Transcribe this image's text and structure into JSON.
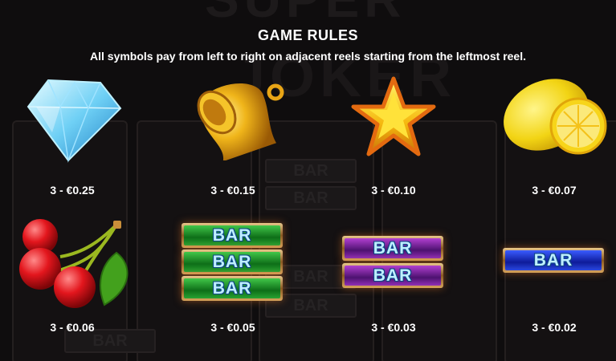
{
  "header": {
    "title": "GAME RULES",
    "subtitle": "All symbols pay from left to right on adjacent reels starting from the leftmost reel."
  },
  "background": {
    "logo_text_top": "SUPER",
    "logo_text_mid": "JOKER",
    "reel_bar_label": "BAR"
  },
  "symbols": [
    {
      "name": "diamond",
      "icon": "diamond-icon",
      "payout": "3 - €0.25"
    },
    {
      "name": "bell",
      "icon": "bell-icon",
      "payout": "3 - €0.15"
    },
    {
      "name": "star",
      "icon": "star-icon",
      "payout": "3 - €0.10"
    },
    {
      "name": "lemon",
      "icon": "lemon-icon",
      "payout": "3 - €0.07"
    },
    {
      "name": "cherry",
      "icon": "cherry-icon",
      "payout": "3 - €0.06"
    },
    {
      "name": "triple-bar",
      "bar_labels": [
        "BAR",
        "BAR",
        "BAR"
      ],
      "color": "#1f9a2a",
      "payout": "3 - €0.05"
    },
    {
      "name": "double-bar",
      "bar_labels": [
        "BAR",
        "BAR"
      ],
      "color": "#7a1fa3",
      "payout": "3 - €0.03"
    },
    {
      "name": "single-bar",
      "bar_labels": [
        "BAR"
      ],
      "color": "#1a2fd0",
      "payout": "3 - €0.02"
    }
  ],
  "colors": {
    "background": "#0f0d0e",
    "text": "#ffffff",
    "bar_frame": "#c48a3e"
  }
}
